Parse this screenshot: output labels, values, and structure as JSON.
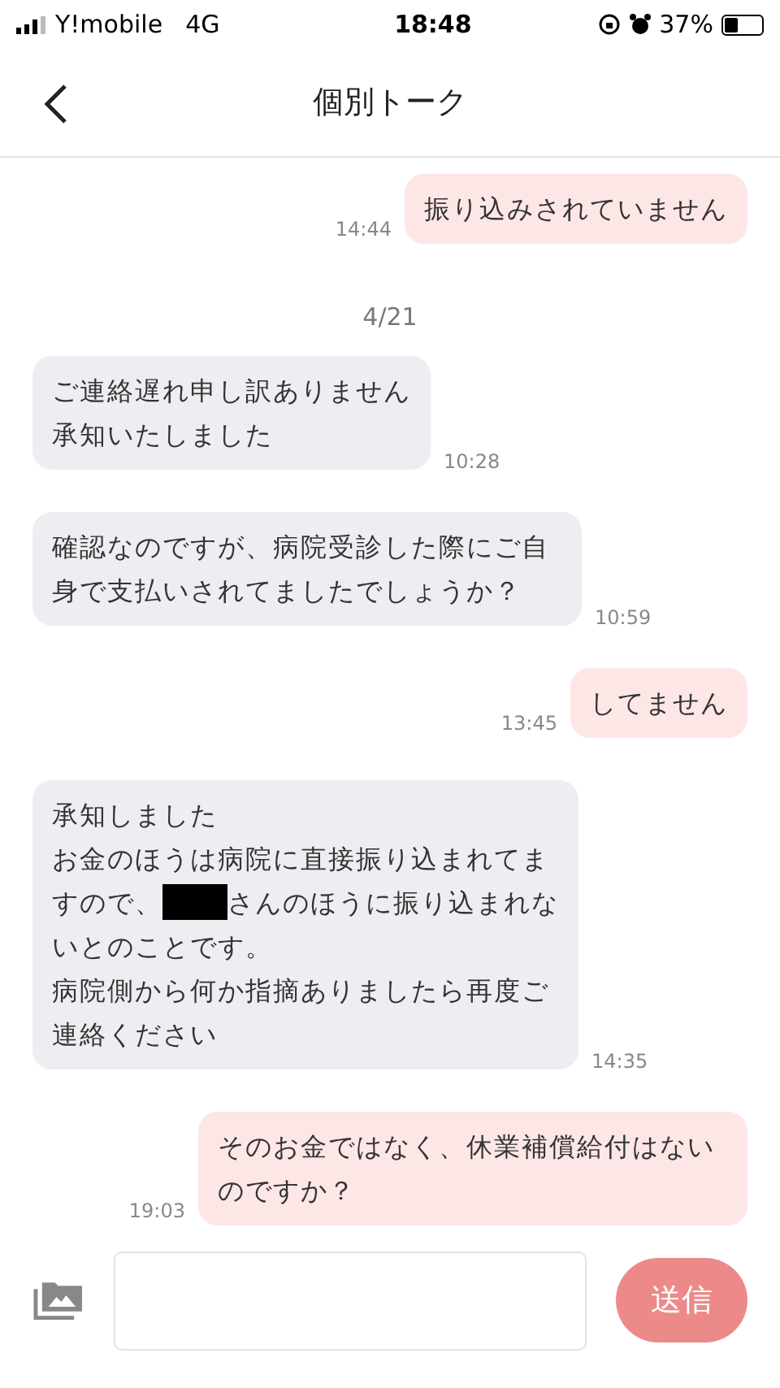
{
  "status_bar": {
    "carrier": "Y!mobile",
    "network": "4G",
    "time": "18:48",
    "battery_text": "37%"
  },
  "header": {
    "title": "個別トーク"
  },
  "messages": [
    {
      "kind": "sent",
      "lines": [
        {
          "text": "振り込みされていません"
        }
      ],
      "time": "14:44"
    },
    {
      "kind": "date",
      "text": "4/21"
    },
    {
      "kind": "received",
      "lines": [
        {
          "text": "ご連絡遅れ申し訳ありません"
        },
        {
          "text": "承知いたしました"
        }
      ],
      "time": "10:28"
    },
    {
      "kind": "received",
      "lines": [
        {
          "text": "確認なのですが、病院受診した際にご自身で支払いされてましたでしょうか？"
        }
      ],
      "time": "10:59"
    },
    {
      "kind": "sent",
      "lines": [
        {
          "text": "してません"
        }
      ],
      "time": "13:45"
    },
    {
      "kind": "received",
      "lines": [
        {
          "text": "承知しました"
        },
        {
          "text": "お金のほうは病院に直接振り込まれてま"
        },
        {
          "text": "すので、",
          "redacted": true,
          "text_after": "さんのほうに振り込まれな"
        },
        {
          "text": "いとのことです。"
        },
        {
          "text": "病院側から何か指摘ありましたら再度ご"
        },
        {
          "text": "連絡ください"
        }
      ],
      "time": "14:35"
    },
    {
      "kind": "sent",
      "lines": [
        {
          "text": "そのお金ではなく、休業補償給付はないのですか？"
        }
      ],
      "time": "19:03"
    }
  ],
  "composer": {
    "send_label": "送信",
    "send_disabled": true
  }
}
